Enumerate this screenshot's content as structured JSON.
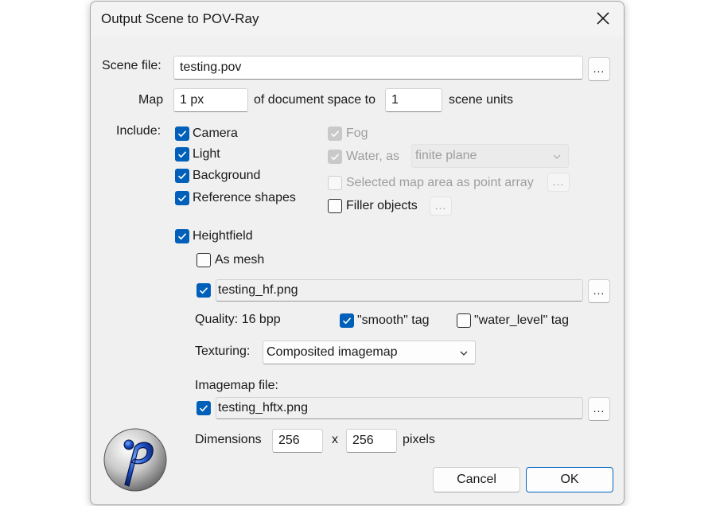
{
  "window": {
    "title": "Output Scene to POV-Ray"
  },
  "scene_file": {
    "label": "Scene file:",
    "value": "testing.pov",
    "browse_label": "..."
  },
  "map": {
    "label": "Map",
    "document_value": "1 px",
    "middle_text": "of document space to",
    "scene_value": "1",
    "suffix": "scene units"
  },
  "include": {
    "label": "Include:",
    "camera": {
      "label": "Camera",
      "checked": true
    },
    "light": {
      "label": "Light",
      "checked": true
    },
    "background": {
      "label": "Background",
      "checked": true
    },
    "reference_shapes": {
      "label": "Reference shapes",
      "checked": true
    },
    "fog": {
      "label": "Fog",
      "checked": true,
      "enabled": false
    },
    "water": {
      "label": "Water, as",
      "checked": true,
      "enabled": false,
      "mode": "finite plane"
    },
    "selected_area": {
      "label": "Selected map area as point array",
      "checked": false,
      "enabled": false,
      "button_label": "..."
    },
    "filler_objects": {
      "label": "Filler objects",
      "checked": false,
      "button_label": "..."
    }
  },
  "heightfield": {
    "label": "Heightfield",
    "checked": true,
    "as_mesh": {
      "label": "As mesh",
      "checked": false
    },
    "file": {
      "checked": true,
      "value": "testing_hf.png",
      "browse_label": "..."
    },
    "quality_label": "Quality: 16 bpp",
    "smooth_tag": {
      "label": "\"smooth\" tag",
      "checked": true
    },
    "water_level_tag": {
      "label": "\"water_level\" tag",
      "checked": false
    },
    "texturing": {
      "label": "Texturing:",
      "value": "Composited imagemap"
    },
    "imagemap": {
      "label": "Imagemap file:",
      "checked": true,
      "value": "testing_hftx.png",
      "browse_label": "..."
    },
    "dimensions": {
      "label": "Dimensions",
      "width": "256",
      "separator": "x",
      "height": "256",
      "unit": "pixels"
    }
  },
  "buttons": {
    "cancel": "Cancel",
    "ok": "OK"
  },
  "colors": {
    "accent": "#005fb8",
    "dialog_bg": "#f0f0f0"
  },
  "icons": {
    "app": "pov-ray-logo-icon",
    "close": "close-icon",
    "check": "check-icon",
    "dropdown": "chevron-down-icon"
  }
}
